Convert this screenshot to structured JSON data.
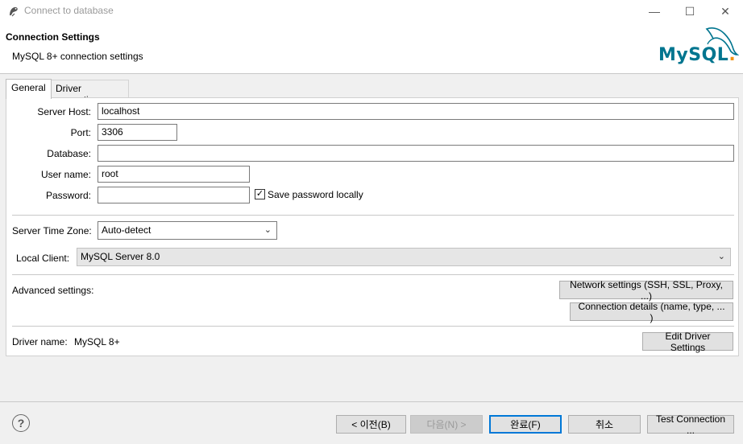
{
  "window": {
    "title": "Connect to database",
    "minimize_glyph": "—",
    "maximize_glyph": "☐",
    "close_glyph": "✕"
  },
  "header": {
    "title": "Connection Settings",
    "subtitle": "MySQL 8+ connection settings",
    "logo_text": "MySQL",
    "logo_dot": ".",
    "colors": {
      "logo_blue": "#00758f",
      "logo_orange": "#f29111"
    }
  },
  "tabs": [
    {
      "label": "General"
    },
    {
      "label": "Driver properties"
    }
  ],
  "form": {
    "server_host": {
      "label": "Server Host:",
      "value": "localhost"
    },
    "port": {
      "label": "Port:",
      "value": "3306"
    },
    "database": {
      "label": "Database:",
      "value": ""
    },
    "user_name": {
      "label": "User name:",
      "value": "root"
    },
    "password": {
      "label": "Password:",
      "value": ""
    },
    "save_password": {
      "label": "Save password locally",
      "checked": true,
      "check_glyph": "✓"
    },
    "server_time_zone": {
      "label": "Server Time Zone:",
      "value": "Auto-detect"
    },
    "local_client": {
      "label": "Local Client:",
      "value": "MySQL Server 8.0"
    },
    "chevron_glyph": "⌄"
  },
  "advanced": {
    "label": "Advanced settings:",
    "network_button": "Network settings (SSH, SSL, Proxy, ...)",
    "connection_button": "Connection details (name, type, ... )"
  },
  "driver": {
    "label": "Driver name:",
    "value": "MySQL 8+",
    "edit_button": "Edit Driver Settings"
  },
  "footer": {
    "help_glyph": "?",
    "back_button": "< 이전(B)",
    "next_button": "다음(N) >",
    "finish_button": "완료(F)",
    "cancel_button": "취소",
    "test_button": "Test Connection ..."
  }
}
